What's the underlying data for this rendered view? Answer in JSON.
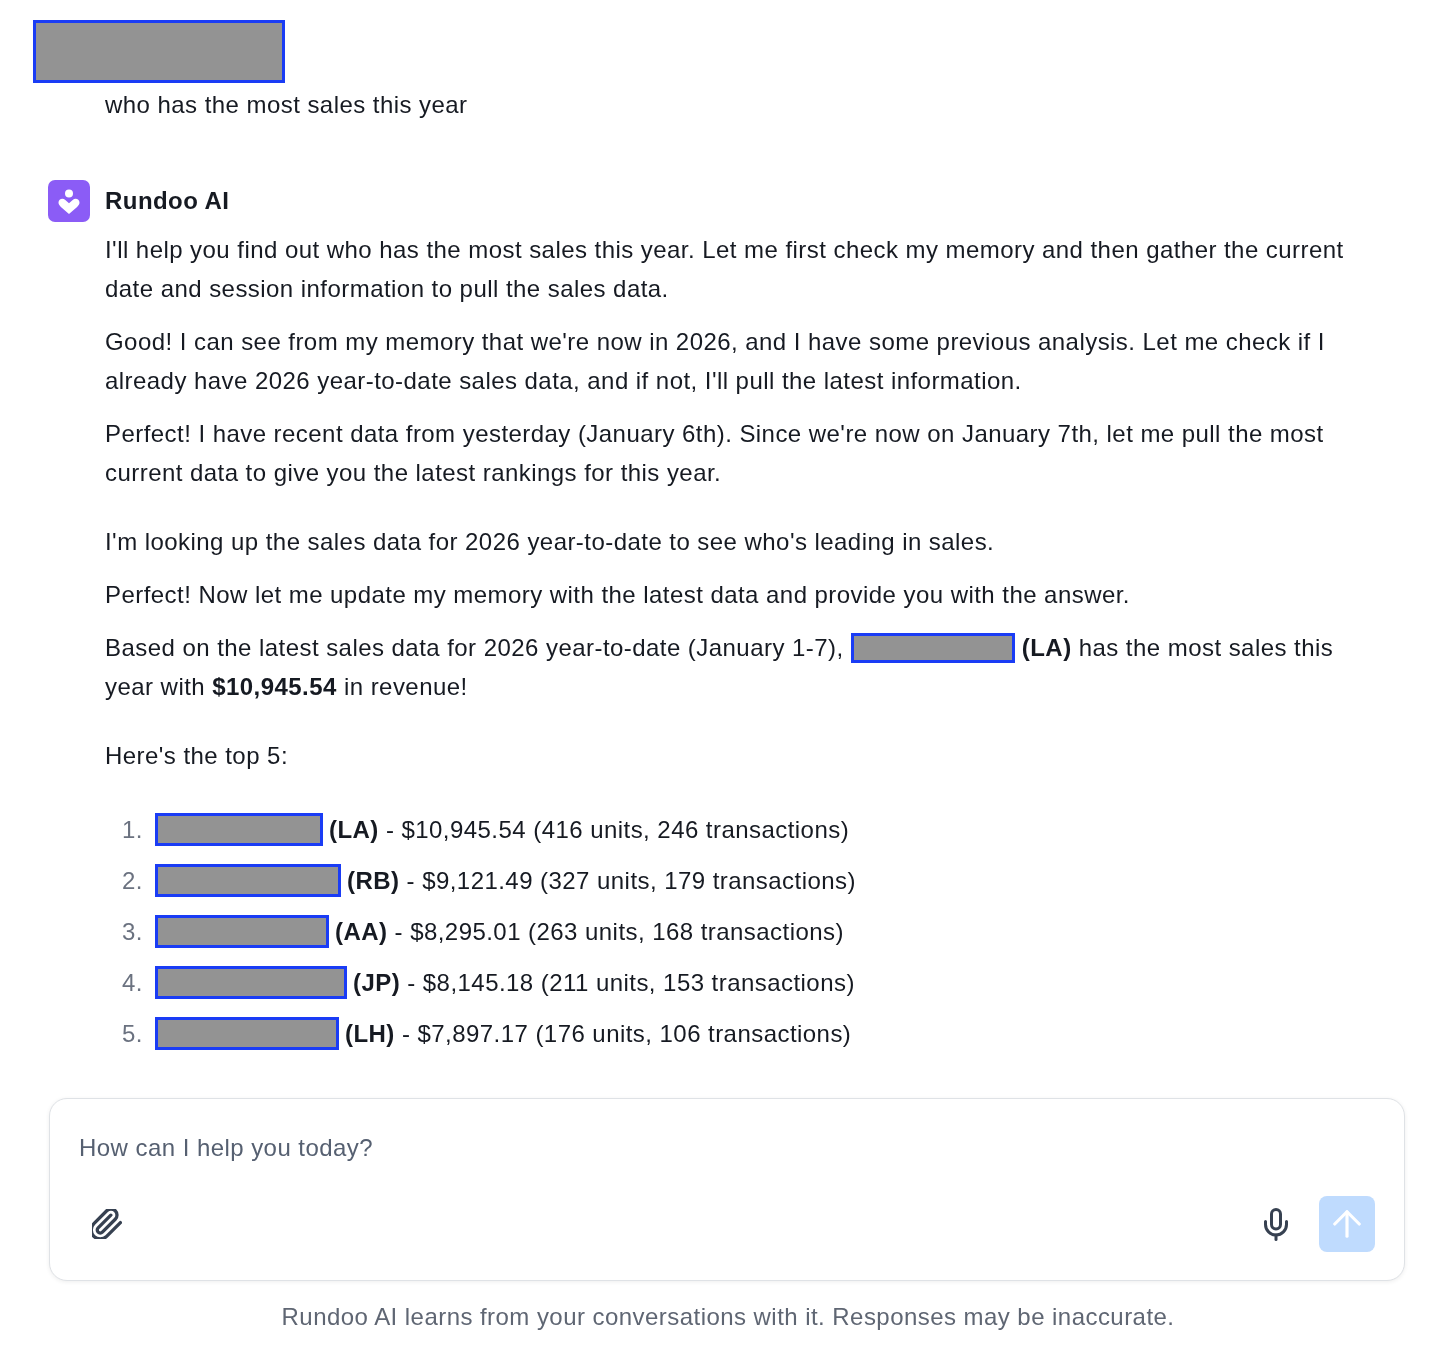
{
  "user_message": {
    "sender": {
      "kind": "redaction"
    },
    "text": "who has the most sales this year"
  },
  "assistant_message": {
    "name": "Rundoo AI",
    "blocks": [
      {
        "paragraphs": [
          {
            "segments": [
              {
                "kind": "text",
                "text": "I'll help you find out who has the most sales this year. Let me first check my memory and then gather the current date and session information to pull the sales data."
              }
            ]
          },
          {
            "segments": [
              {
                "kind": "text",
                "text": "Good! I can see from my memory that we're now in 2026, and I have some previous analysis. Let me check if I already have 2026 year-to-date sales data, and if not, I'll pull the latest information."
              }
            ]
          },
          {
            "segments": [
              {
                "kind": "text",
                "text": "Perfect! I have recent data from yesterday (January 6th). Since we're now on January 7th, let me pull the most current data to give you the latest rankings for this year."
              }
            ]
          }
        ]
      },
      {
        "paragraphs": [
          {
            "segments": [
              {
                "kind": "text",
                "text": "I'm looking up the sales data for 2026 year-to-date to see who's leading in sales."
              }
            ]
          },
          {
            "segments": [
              {
                "kind": "text",
                "text": "Perfect! Now let me update my memory with the latest data and provide you with the answer."
              }
            ]
          },
          {
            "segments": [
              {
                "kind": "text",
                "text": "Based on the latest sales data for 2026 year-to-date (January 1-7),"
              },
              {
                "kind": "redaction"
              },
              {
                "kind": "text",
                "text": "**(LA)** has the most sales this"
              },
              {
                "kind": "text",
                "text": "year with **$10,945.54** in revenue!"
              }
            ]
          }
        ]
      },
      {
        "paragraphs": [
          {
            "segments": [
              {
                "kind": "text",
                "text": "Here's the top 5:"
              }
            ]
          }
        ],
        "list": [
          {
            "number": "1.",
            "segments": [
              {
                "kind": "redaction"
              },
              {
                "kind": "text",
                "text": "**(LA)** - $10,945.54 (416 units, 246 transactions)"
              }
            ]
          },
          {
            "number": "2.",
            "segments": [
              {
                "kind": "redaction"
              },
              {
                "kind": "text",
                "text": "**(RB)** - $9,121.49 (327 units, 179 transactions)"
              }
            ]
          },
          {
            "number": "3.",
            "segments": [
              {
                "kind": "redaction"
              },
              {
                "kind": "text",
                "text": "**(AA)** - $8,295.01 (263 units, 168 transactions)"
              }
            ]
          },
          {
            "number": "4.",
            "segments": [
              {
                "kind": "redaction"
              },
              {
                "kind": "text",
                "text": "**(JP)** - $8,145.18 (211 units, 153 transactions)"
              }
            ]
          },
          {
            "number": "5.",
            "segments": [
              {
                "kind": "redaction"
              },
              {
                "kind": "text",
                "text": "**(LH)** - $7,897.17 (176 units, 106 transactions)"
              }
            ]
          }
        ]
      }
    ]
  },
  "composer": {
    "placeholder": "How can I help you today?",
    "send_button": {
      "disabled": true
    }
  },
  "footer_note": "Rundoo AI learns from your conversations with it. Responses may be inaccurate."
}
